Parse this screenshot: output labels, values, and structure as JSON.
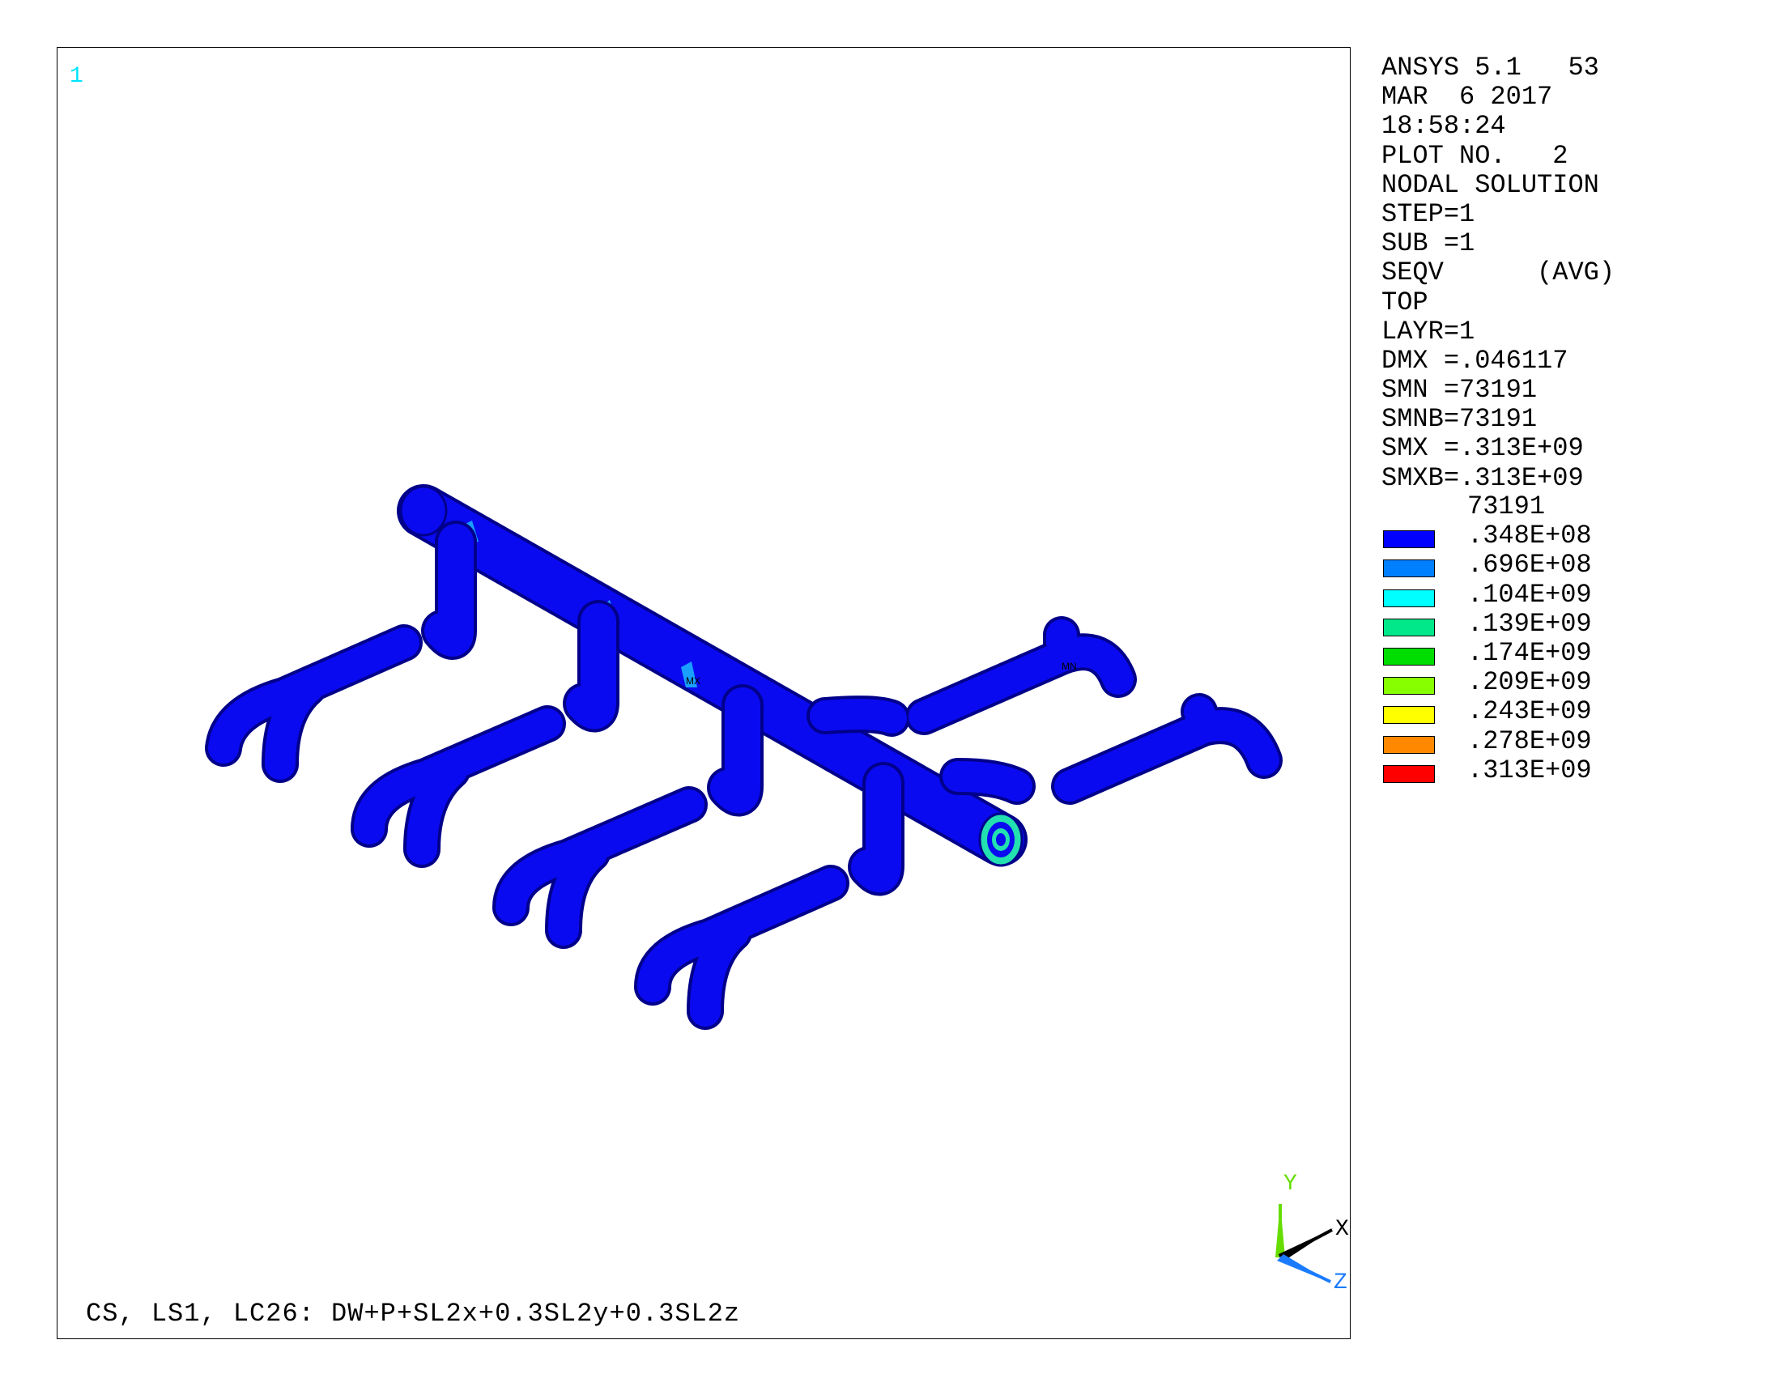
{
  "viewport": {
    "window_number": "1",
    "caption": "CS, LS1, LC26: DW+P+SL2x+0.3SL2y+0.3SL2z",
    "model_labels": [
      "MX",
      "MN"
    ],
    "triad": {
      "x_label": "X",
      "y_label": "Y",
      "z_label": "Z",
      "x_color": "#000000",
      "y_color": "#66dd00",
      "z_color": "#1a7bff"
    }
  },
  "info_panel": {
    "lines": [
      "ANSYS 5.1   53",
      "MAR  6 2017",
      "18:58:24",
      "PLOT NO.   2",
      "NODAL SOLUTION",
      "STEP=1",
      "SUB =1",
      "SEQV      (AVG)",
      "TOP",
      "LAYR=1",
      "DMX =.046117",
      "SMN =73191",
      "SMNB=73191",
      "SMX =.313E+09",
      "SMXB=.313E+09"
    ]
  },
  "legend": {
    "min_label": "73191",
    "bands": [
      {
        "color": "#0000ff",
        "label": ".348E+08"
      },
      {
        "color": "#0080ff",
        "label": ".696E+08"
      },
      {
        "color": "#00ffff",
        "label": ".104E+09"
      },
      {
        "color": "#00e88a",
        "label": ".139E+09"
      },
      {
        "color": "#00dd00",
        "label": ".174E+09"
      },
      {
        "color": "#88ff00",
        "label": ".209E+09"
      },
      {
        "color": "#ffff00",
        "label": ".243E+09"
      },
      {
        "color": "#ff8800",
        "label": ".278E+09"
      },
      {
        "color": "#ff0000",
        "label": ".313E+09"
      }
    ]
  },
  "colors": {
    "pipe": "#0a0af0",
    "pipe_edge": "#00008a",
    "stress_hotspot": "#1a9fff",
    "outlet_ring": "#22e0b0"
  }
}
